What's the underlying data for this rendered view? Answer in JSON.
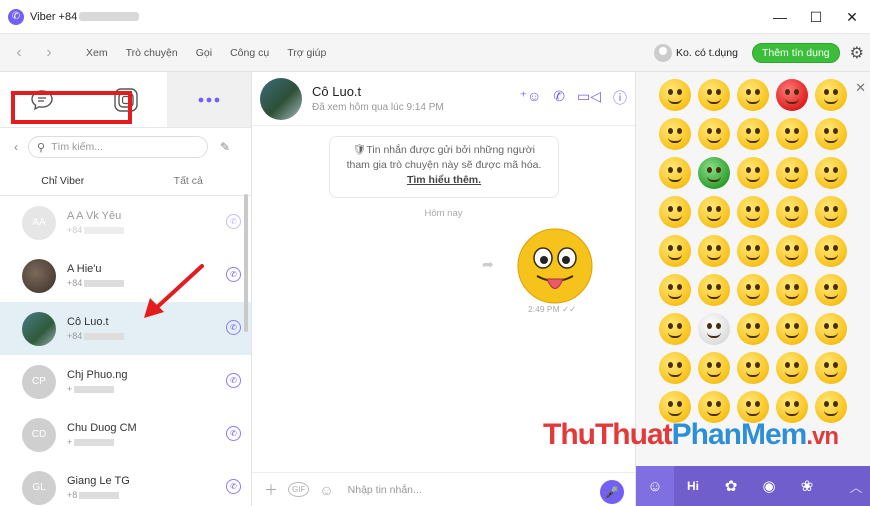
{
  "window": {
    "title": "Viber +84",
    "controls": {
      "minimize": "—",
      "maximize": "☐",
      "close": "✕"
    }
  },
  "menu": {
    "items": [
      "Xem",
      "Trò chuyện",
      "Gọi",
      "Công cụ",
      "Trợ giúp"
    ],
    "credit_label": "Ko. có t.dụng",
    "credit_button": "Thêm tín dụng"
  },
  "left": {
    "search_placeholder": "Tìm kiếm...",
    "tabs": {
      "viber_only": "Chỉ Viber",
      "all": "Tất cả"
    },
    "contacts": [
      {
        "initials": "AA",
        "name": "A A Vk Yêu",
        "num": "+84"
      },
      {
        "initials": "",
        "name": "A Hie'u",
        "num": "+84"
      },
      {
        "initials": "",
        "name": "Cô Luo.t",
        "num": "+84"
      },
      {
        "initials": "CP",
        "name": "Chj Phuo.ng",
        "num": "+"
      },
      {
        "initials": "CD",
        "name": "Chu Duog CM",
        "num": "+"
      },
      {
        "initials": "GL",
        "name": "Giang Le TG",
        "num": "+8"
      }
    ]
  },
  "chat": {
    "name": "Cô Luo.t",
    "subtitle": "Đã xem hôm qua lúc 9:14 PM",
    "notice_line1": "🛡Tin nhắn được gửi bởi những người",
    "notice_line2": "tham gia trò chuyện này sẽ được mã hóa.",
    "notice_link": "Tìm hiểu thêm.",
    "day_label": "Hôm nay",
    "msg_time": "2:49 PM ✓✓",
    "input_placeholder": "Nhập tin nhắn...",
    "gif_label": "GIF"
  },
  "emoji_bar": {
    "hi_label": "Hi"
  },
  "watermark": {
    "part1": "ThuThuat",
    "part2": "PhanMem",
    "part3": ".vn"
  }
}
